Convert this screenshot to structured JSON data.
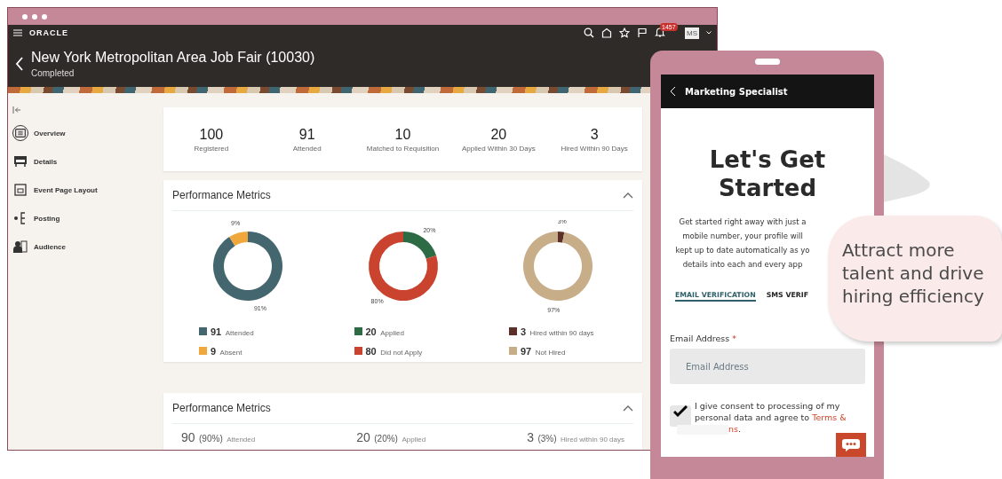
{
  "desktop": {
    "app_bar": {
      "logo": "ORACLE",
      "notification_count": "1457",
      "avatar_initials": "MS"
    },
    "page_header": {
      "title": "New York Metropolitan Area Job Fair (10030)",
      "subtitle": "Completed"
    },
    "sidebar": {
      "items": [
        {
          "label": "Overview",
          "selected": true
        },
        {
          "label": "Details",
          "selected": false
        },
        {
          "label": "Event Page Layout",
          "selected": false
        },
        {
          "label": "Posting",
          "selected": false
        },
        {
          "label": "Audience",
          "selected": false
        }
      ]
    },
    "stats": [
      {
        "value": "100",
        "label": "Registered"
      },
      {
        "value": "91",
        "label": "Attended"
      },
      {
        "value": "10",
        "label": "Matched to Requisition"
      },
      {
        "value": "20",
        "label": "Applied Within 30 Days"
      },
      {
        "value": "3",
        "label": "Hired Within 90 Days"
      }
    ],
    "metrics_card": {
      "title": "Performance Metrics",
      "expanded": true,
      "charts": [
        {
          "chart_data": {
            "type": "donut",
            "categories": [
              "Attended",
              "Absent"
            ],
            "values": [
              91,
              9
            ],
            "value_labels": [
              "91%",
              "9%"
            ]
          },
          "legend": [
            {
              "value": "91",
              "color": "#44666e"
            },
            {
              "value": "9",
              "color": "#f0a83c"
            }
          ]
        },
        {
          "chart_data": {
            "type": "donut",
            "categories": [
              "Applied",
              "Did not Apply"
            ],
            "values": [
              20,
              80
            ],
            "value_labels": [
              "20%",
              "80%"
            ]
          },
          "legend": [
            {
              "value": "20",
              "color": "#2d6b45"
            },
            {
              "value": "80",
              "color": "#c9432f"
            }
          ]
        },
        {
          "chart_data": {
            "type": "donut",
            "categories": [
              "Hired within 90 days",
              "Not Hired"
            ],
            "values": [
              3,
              97
            ],
            "value_labels": [
              "3%",
              "97%"
            ]
          },
          "legend": [
            {
              "value": "3",
              "color": "#5a3028"
            },
            {
              "value": "97",
              "color": "#c8ad89"
            }
          ]
        }
      ]
    },
    "summary_card": {
      "title": "Performance Metrics",
      "expanded": true,
      "items": [
        {
          "count": "90",
          "percent": "(90%)",
          "caption": "Attended"
        },
        {
          "count": "20",
          "percent": "(20%)",
          "caption": "Applied"
        },
        {
          "count": "3",
          "percent": "(3%)",
          "caption": "Hired within 90 days"
        }
      ]
    }
  },
  "phone": {
    "header_title": "Marketing Specialist",
    "heading": "Let's Get Started",
    "intro_lines": [
      "Get started right away with just a",
      "mobile number, your profile will",
      "kept up to date automatically as yo",
      "details into each and every app"
    ],
    "tabs": [
      {
        "label": "EMAIL VERIFICATION",
        "selected": true
      },
      {
        "label": "SMS VERIF",
        "selected": false
      }
    ],
    "email_field": {
      "label": "Email Address",
      "required_mark": "*",
      "placeholder": "Email Address"
    },
    "consent": {
      "checked": true,
      "text": "I give consent to processing of my personal data and agree to",
      "link": "Terms &",
      "link_tail": "ns",
      "tail": "."
    }
  },
  "callout": {
    "text": "Attract more talent and drive hiring efficiency"
  }
}
